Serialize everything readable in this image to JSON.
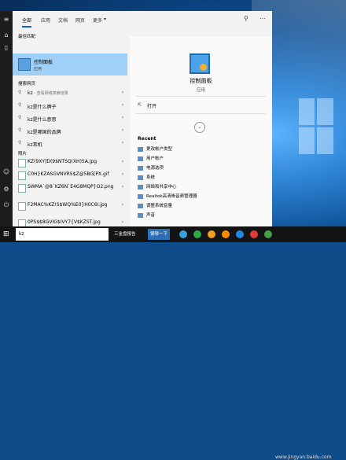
{
  "tabs": [
    "全部",
    "应用",
    "文档",
    "网页",
    "更多"
  ],
  "left": {
    "best_match_header": "最佳匹配",
    "best_match": {
      "title": "控制面板",
      "subtitle": "应用"
    },
    "web_header": "搜索网页",
    "web_results": [
      {
        "text": "kz",
        "sub": " - 查看网络搜索结果"
      },
      {
        "text": "kz是什么牌子",
        "sub": ""
      },
      {
        "text": "kz是什么意思",
        "sub": ""
      },
      {
        "text": "kz是哪国的品牌",
        "sub": ""
      },
      {
        "text": "kz耳机",
        "sub": ""
      }
    ],
    "photos_header": "照片",
    "photos": [
      "KZ(9XY]D(9$NTSQ(XH)SA.jpg",
      "C0H}KZASGVNVRS$Z@5BG[PX.gif",
      "SWMA`@8`KZ6N`E4G8MQP}O2.png",
      "F2MAC%KZ!S$WQ%E0}H0C6I.jpg",
      "0PS$$8GVIG$IVY7{V$KZST.jpg"
    ]
  },
  "right": {
    "app_title": "控制面板",
    "app_subtitle": "应用",
    "open_label": "打开",
    "recent_header": "Recent",
    "recent_items": [
      "更改帐户类型",
      "用户帐户",
      "电源选项",
      "系统",
      "网络和共享中心",
      "Realtek高清晰音频管理器",
      "调整系统音量",
      "声音"
    ]
  },
  "taskbar": {
    "search_value": "kz",
    "items": [
      "三金盘报告",
      "钢琴一下"
    ]
  },
  "watermark": "www.jingyan.baidu.com",
  "colors": {
    "selected": "#9fd0f8",
    "accent": "#0a64c8",
    "taskbar": "#141414"
  }
}
